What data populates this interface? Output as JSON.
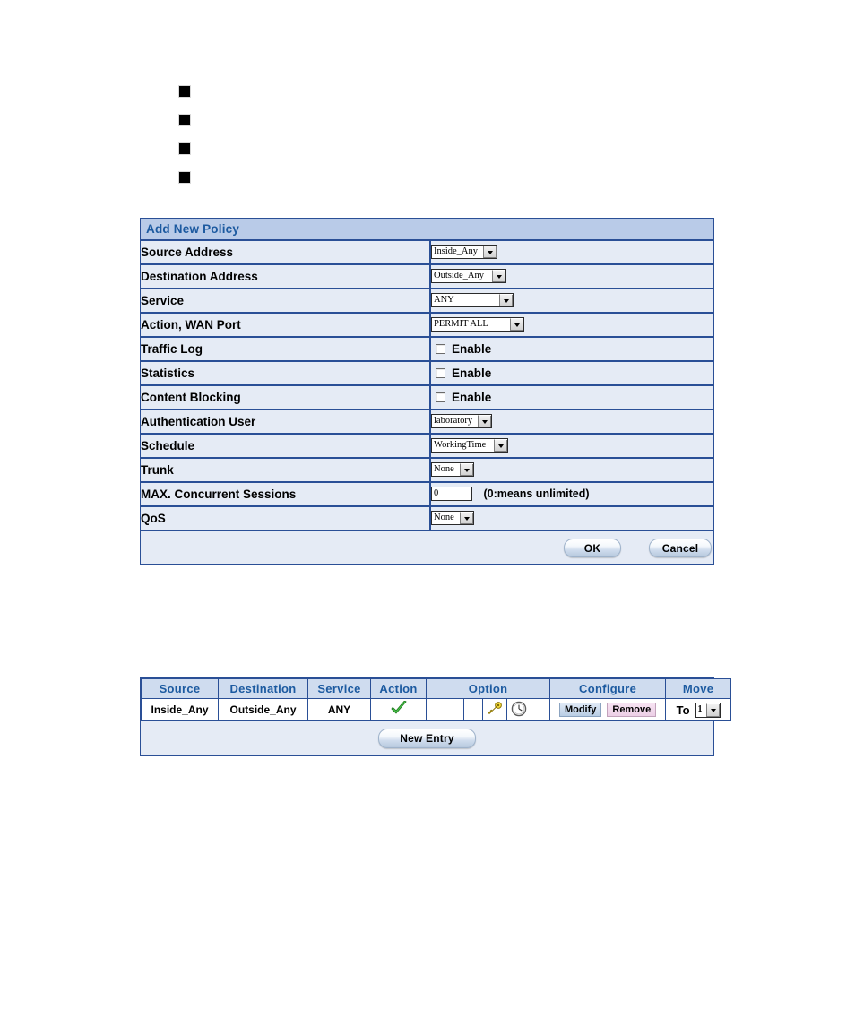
{
  "bullets": {
    "count": 4,
    "marker": "black-square"
  },
  "policy_form": {
    "title": "Add New Policy",
    "rows": [
      {
        "label": "Source Address",
        "type": "select",
        "value": "Inside_Any",
        "size": "w-inside"
      },
      {
        "label": "Destination Address",
        "type": "select",
        "value": "Outside_Any",
        "size": "w-outside"
      },
      {
        "label": "Service",
        "type": "select",
        "value": "ANY",
        "size": "w-service"
      },
      {
        "label": "Action, WAN Port",
        "type": "select",
        "value": "PERMIT ALL",
        "size": "w-action"
      },
      {
        "label": "Traffic Log",
        "type": "checkbox",
        "value": "Enable",
        "checked": false
      },
      {
        "label": "Statistics",
        "type": "checkbox",
        "value": "Enable",
        "checked": false
      },
      {
        "label": "Content Blocking",
        "type": "checkbox",
        "value": "Enable",
        "checked": false
      },
      {
        "label": "Authentication User",
        "type": "select",
        "value": "laboratory",
        "size": "w-auth"
      },
      {
        "label": "Schedule",
        "type": "select",
        "value": "WorkingTime",
        "size": "w-sched"
      },
      {
        "label": "Trunk",
        "type": "select",
        "value": "None",
        "size": "w-none"
      },
      {
        "label": "MAX. Concurrent Sessions",
        "type": "text",
        "value": "0",
        "hint": "(0:means unlimited)"
      },
      {
        "label": "QoS",
        "type": "select",
        "value": "None",
        "size": "w-none"
      }
    ],
    "buttons": {
      "ok": "OK",
      "cancel": "Cancel"
    }
  },
  "policy_list": {
    "headers": {
      "source": "Source",
      "destination": "Destination",
      "service": "Service",
      "action": "Action",
      "option": "Option",
      "configure": "Configure",
      "move": "Move"
    },
    "row": {
      "source": "Inside_Any",
      "destination": "Outside_Any",
      "service": "ANY",
      "action_icon": "green-check-icon",
      "option_icons": [
        "",
        "",
        "",
        "key-icon",
        "clock-icon",
        ""
      ],
      "modify_label": "Modify",
      "remove_label": "Remove",
      "move_label": "To",
      "move_value": "1"
    },
    "new_entry_label": "New Entry"
  },
  "colors": {
    "panel_border": "#2a4f96",
    "title_bg": "#b9cbe8",
    "title_text": "#1c5aa0",
    "row_bg": "#e5ebf5",
    "list_header_bg": "#cfdcef",
    "check_green": "#44b944",
    "key_yellow": "#f2d22a",
    "remove_pink": "#eccfe6"
  }
}
